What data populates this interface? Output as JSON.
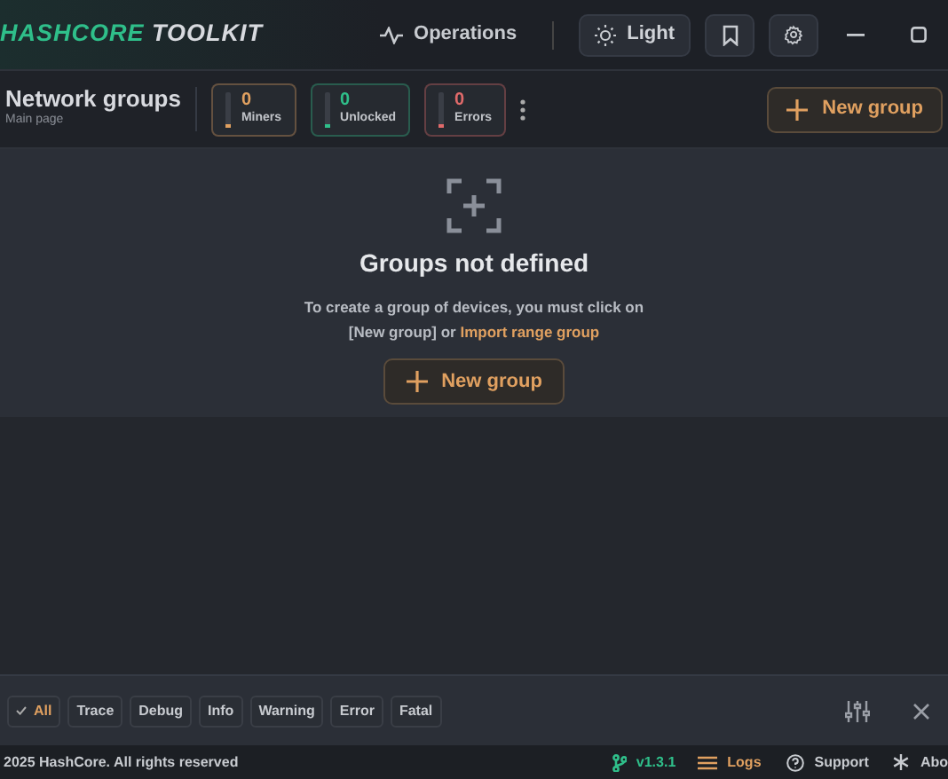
{
  "header": {
    "brand_accent": "HASHCORE",
    "brand_rest": "TOOLKIT",
    "nav": [
      {
        "kind": "operations",
        "label": "Operations"
      },
      {
        "kind": "theme",
        "label": "Light"
      },
      {
        "kind": "bookmark"
      },
      {
        "kind": "settings"
      }
    ]
  },
  "page": {
    "title": "Network groups",
    "subtitle": "Main page",
    "stats": [
      {
        "value": "0",
        "label": "Miners",
        "color": "#e0a060"
      },
      {
        "value": "0",
        "label": "Unlocked",
        "color": "#2fbf8a"
      },
      {
        "value": "0",
        "label": "Errors",
        "color": "#e06a6a"
      }
    ],
    "new_button": "New group"
  },
  "empty": {
    "title": "Groups not defined",
    "text": "To create a group of devices, you must click on",
    "text2": "[New group] or",
    "link": "Import range group",
    "button": "New group"
  },
  "log_filters": [
    {
      "label": "All",
      "selected": true
    },
    {
      "label": "Trace",
      "selected": false
    },
    {
      "label": "Debug",
      "selected": false
    },
    {
      "label": "Info",
      "selected": false
    },
    {
      "label": "Warning",
      "selected": false
    },
    {
      "label": "Error",
      "selected": false
    },
    {
      "label": "Fatal",
      "selected": false
    }
  ],
  "footer": {
    "copyright": "2025 HashCore. All rights reserved",
    "version": "v1.3.1",
    "links": [
      {
        "kind": "logs",
        "label": "Logs"
      },
      {
        "kind": "support",
        "label": "Support"
      },
      {
        "kind": "about",
        "label": "Abo"
      }
    ]
  }
}
